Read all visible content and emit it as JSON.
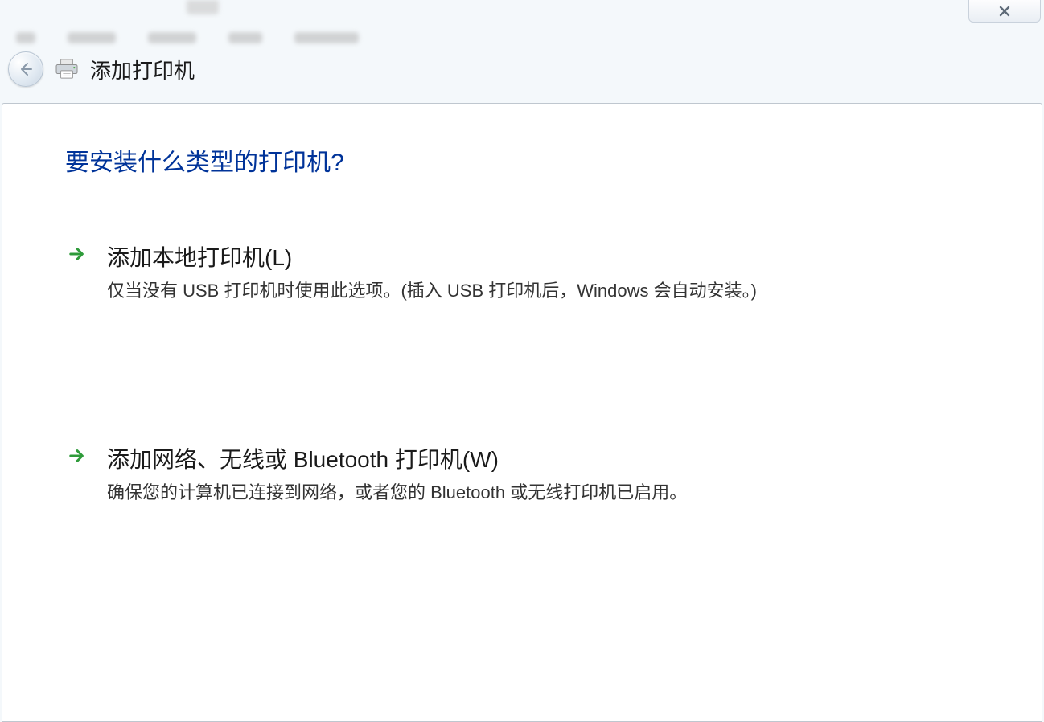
{
  "header": {
    "title": "添加打印机"
  },
  "main": {
    "question": "要安装什么类型的打印机?",
    "options": [
      {
        "title": "添加本地打印机(L)",
        "desc": "仅当没有 USB 打印机时使用此选项。(插入 USB 打印机后，Windows 会自动安装。)"
      },
      {
        "title": "添加网络、无线或 Bluetooth 打印机(W)",
        "desc": "确保您的计算机已连接到网络，或者您的 Bluetooth 或无线打印机已启用。"
      }
    ]
  },
  "colors": {
    "heading": "#003399",
    "arrow": "#2e9b3a"
  }
}
